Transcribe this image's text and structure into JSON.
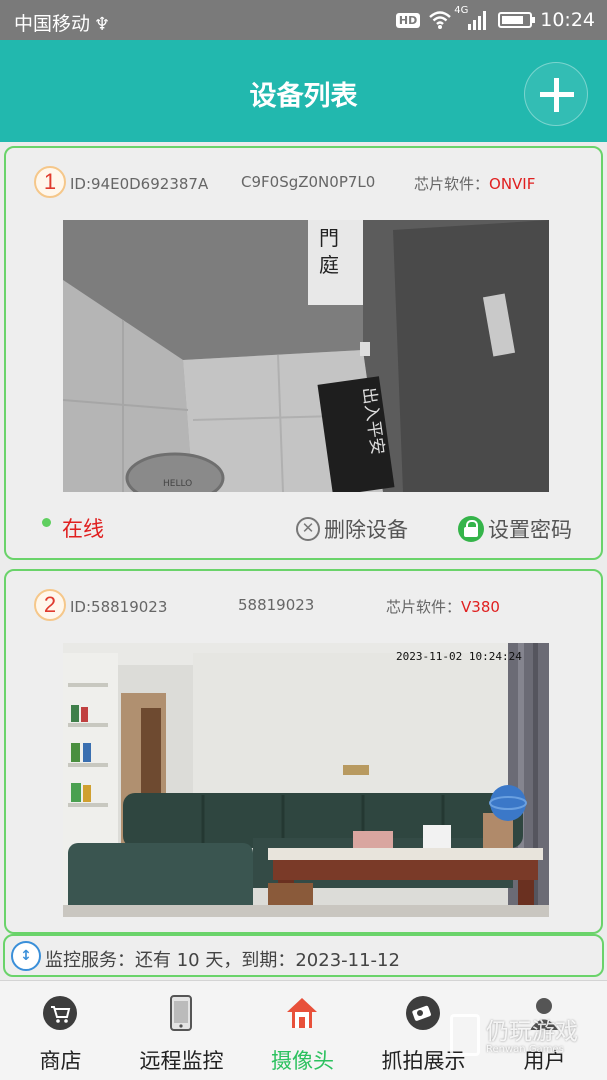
{
  "status_bar": {
    "carrier": "中国移动",
    "usb_symbol": "♆",
    "hd_badge": "HD",
    "network_type": "4G",
    "time": "10:24",
    "battery_level": 0.8
  },
  "header": {
    "title": "设备列表",
    "add_icon": "plus-icon"
  },
  "devices": [
    {
      "index": "1",
      "id": "ID:94E0D692387A",
      "code": "C9F0SgZ0N0P7L0",
      "chip_label": "芯片软件：",
      "chip_value": "ONVIF",
      "feed_sign_text": "出入平安",
      "feed_mat_text": "HELLO",
      "status": "在线",
      "delete_label": "删除设备",
      "password_label": "设置密码"
    },
    {
      "index": "2",
      "id": "ID:58819023",
      "code": "58819023",
      "chip_label": "芯片软件：",
      "chip_value": "V380",
      "feed_timestamp": "2023-11-02 10:24:24"
    }
  ],
  "service": {
    "text": "监控服务：还有 10 天，到期：2023-11-12"
  },
  "nav": {
    "items": [
      {
        "label": "商店",
        "icon": "cart-icon"
      },
      {
        "label": "远程监控",
        "icon": "phone-icon"
      },
      {
        "label": "摄像头",
        "icon": "home-icon",
        "active": true
      },
      {
        "label": "抓拍展示",
        "icon": "camera-icon"
      },
      {
        "label": "用户",
        "icon": "user-icon"
      }
    ]
  },
  "watermark": {
    "text": "仍玩游戏",
    "sub": "Renwan Games"
  },
  "colors": {
    "header": "#22b8ae",
    "card_border": "#6ad36a",
    "alert_red": "#e02020",
    "nav_active": "#2cc15f"
  }
}
